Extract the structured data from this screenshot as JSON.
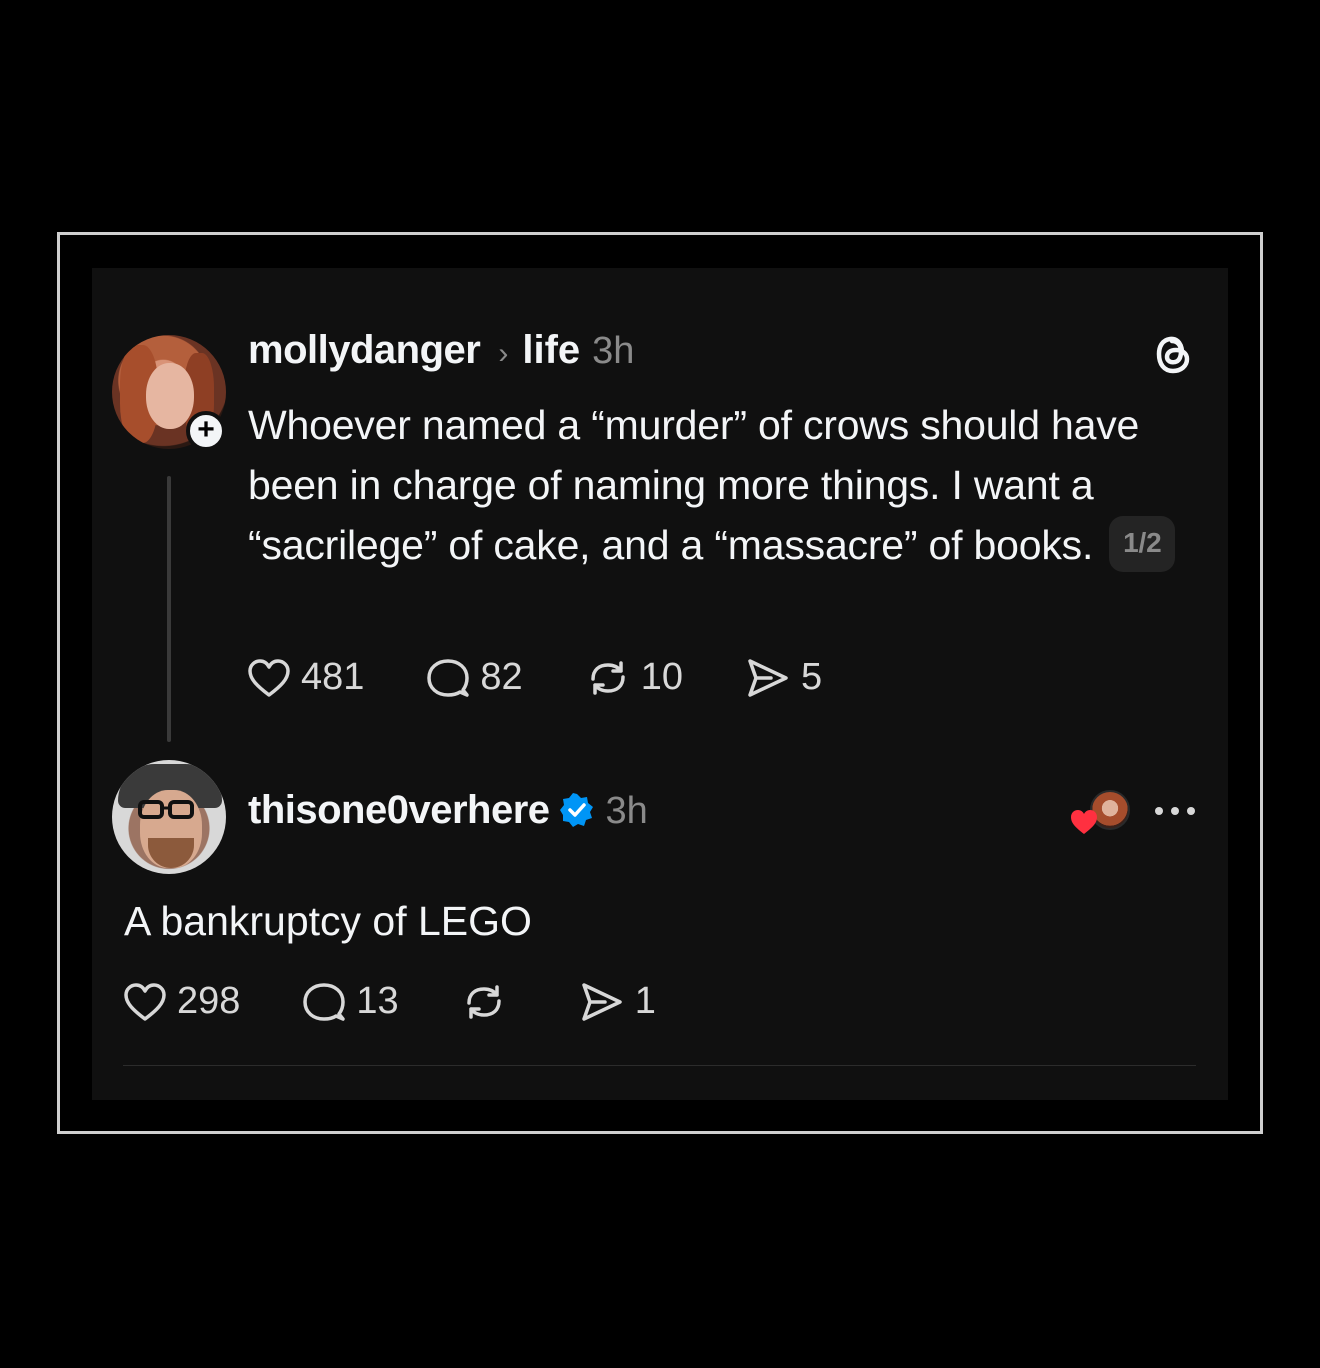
{
  "post": {
    "username": "mollydanger",
    "topic": "life",
    "time": "3h",
    "text": "Whoever named a “murder” of crows should have been in charge of naming more things. I want a “sacrilege” of  cake, and a “massacre” of books.",
    "page_indicator": "1/2",
    "likes": "481",
    "replies": "82",
    "reposts": "10",
    "shares": "5"
  },
  "reply": {
    "username": "thisone0verhere",
    "time": "3h",
    "text": "A bankruptcy of LEGO",
    "likes": "298",
    "replies": "13",
    "reposts": "",
    "shares": "1"
  },
  "icons": {
    "app_logo": "threads-icon",
    "like": "heart-icon",
    "reply": "comment-icon",
    "repost": "repost-icon",
    "share": "send-icon",
    "verified": "verified-badge-icon",
    "more": "more-options-icon",
    "follow": "plus-icon"
  },
  "colors": {
    "background": "#101010",
    "text": "#f3f5f7",
    "muted": "#8a8a8a",
    "verified": "#0095f6",
    "liked_heart": "#ff3040"
  }
}
